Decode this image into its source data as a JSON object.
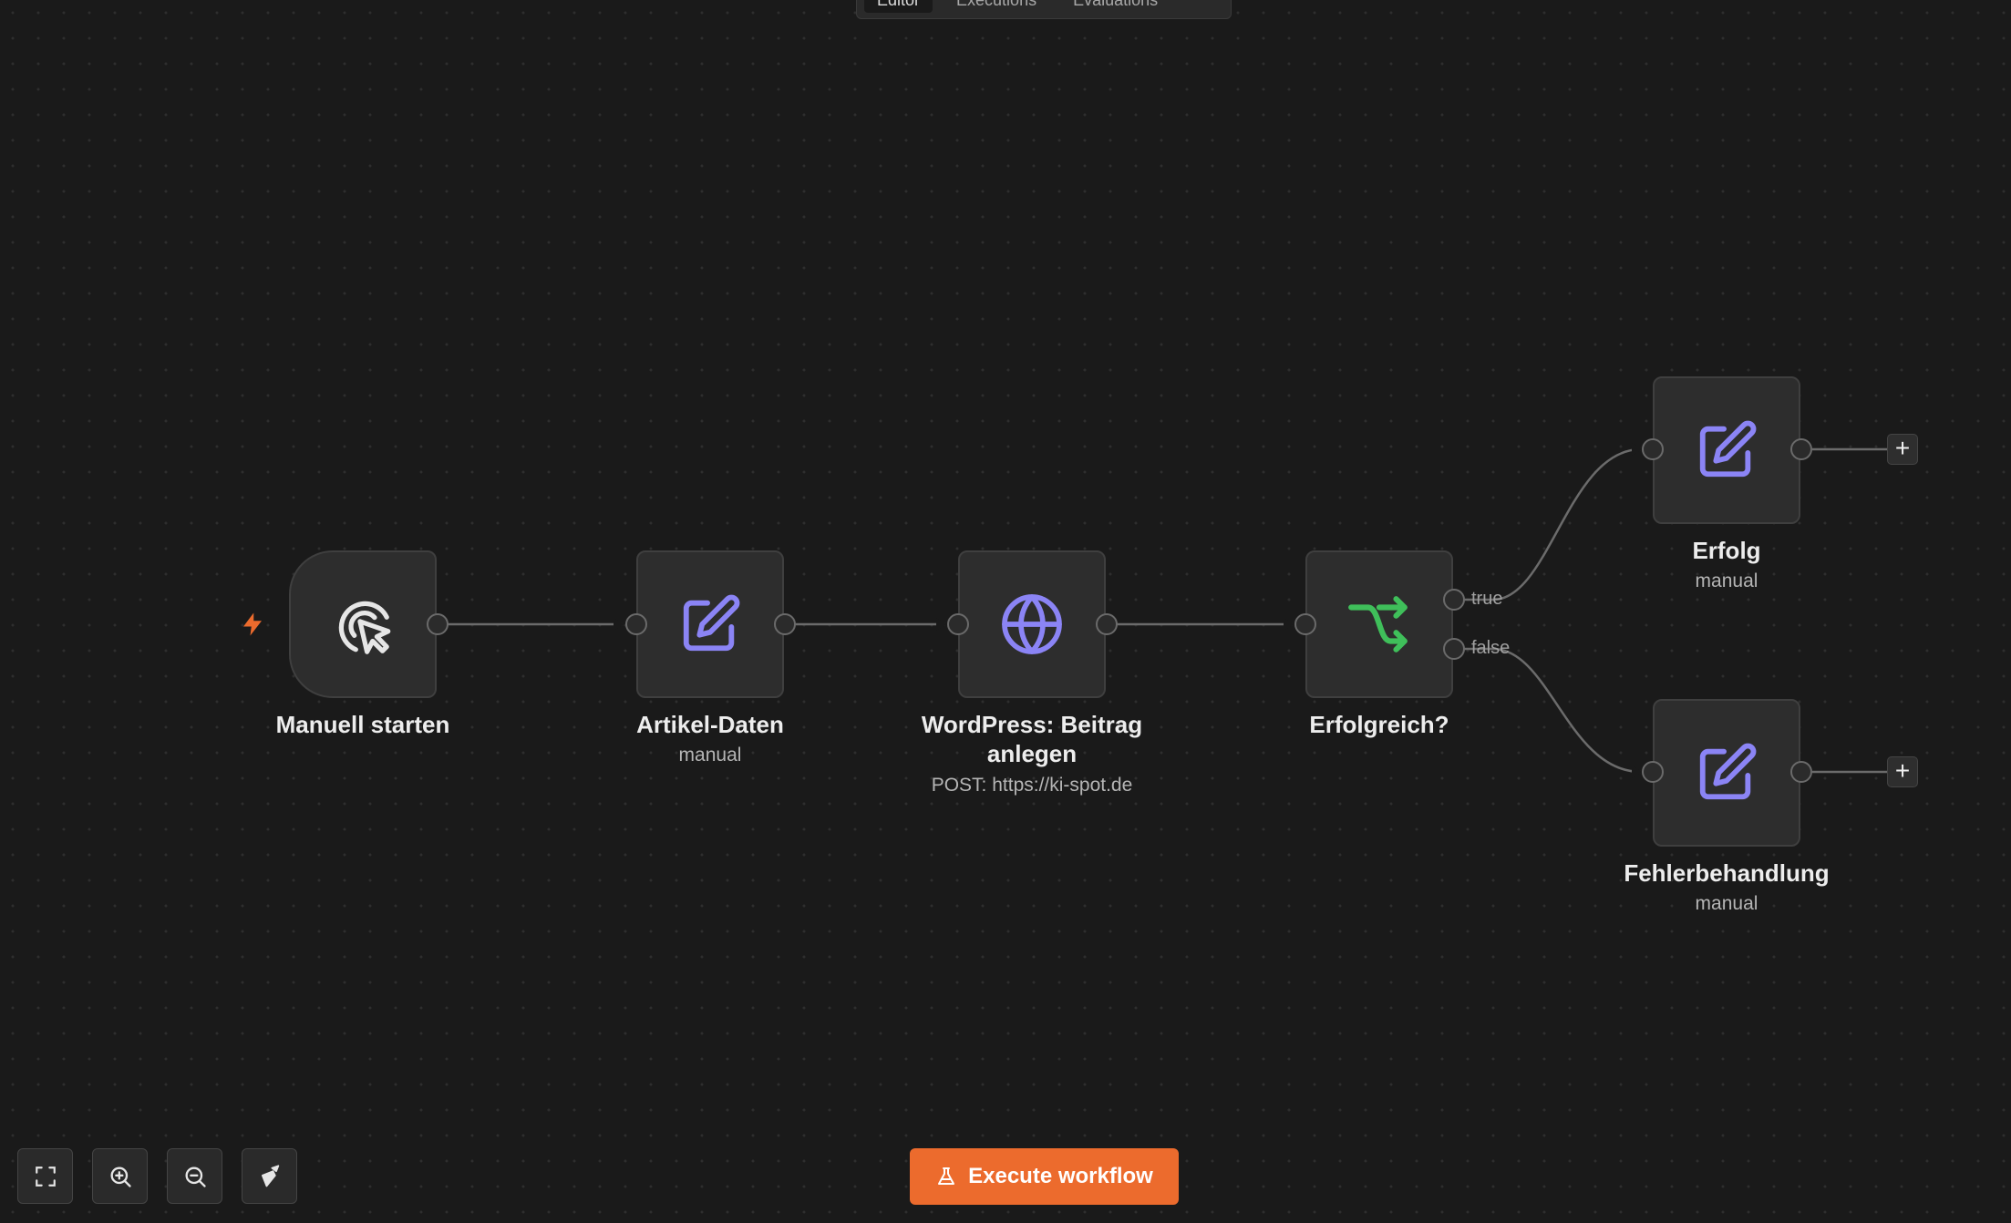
{
  "tabs": [
    {
      "label": "Editor",
      "active": true
    },
    {
      "label": "Executions",
      "active": false
    },
    {
      "label": "Evaluations",
      "active": false
    }
  ],
  "nodes": {
    "manual_trigger": {
      "title": "Manuell starten",
      "icon": "cursor-click-icon"
    },
    "artikel_daten": {
      "title": "Artikel-Daten",
      "subtitle": "manual",
      "icon": "edit-icon"
    },
    "wordpress": {
      "title_line1": "WordPress: Beitrag",
      "title_line2": "anlegen",
      "subtitle": "POST: https://ki-spot.de",
      "icon": "globe-icon"
    },
    "erfolgreich": {
      "title": "Erfolgreich?",
      "icon": "if-branch-icon",
      "branch_true": "true",
      "branch_false": "false"
    },
    "erfolg": {
      "title": "Erfolg",
      "subtitle": "manual",
      "icon": "edit-icon"
    },
    "fehlerbehandlung": {
      "title": "Fehlerbehandlung",
      "subtitle": "manual",
      "icon": "edit-icon"
    }
  },
  "add_node_label": "+",
  "toolbar": {
    "fit_view": "fit-view-icon",
    "zoom_in": "zoom-in-icon",
    "zoom_out": "zoom-out-icon",
    "tidy_up": "broom-icon"
  },
  "execute_button": {
    "label": "Execute workflow",
    "icon": "flask-icon"
  },
  "colors": {
    "background": "#1a1a1a",
    "node_bg": "#2d2d2d",
    "accent_orange": "#ec6b2d",
    "edit_icon": "#8b84f5",
    "if_icon": "#3fbf5a"
  }
}
